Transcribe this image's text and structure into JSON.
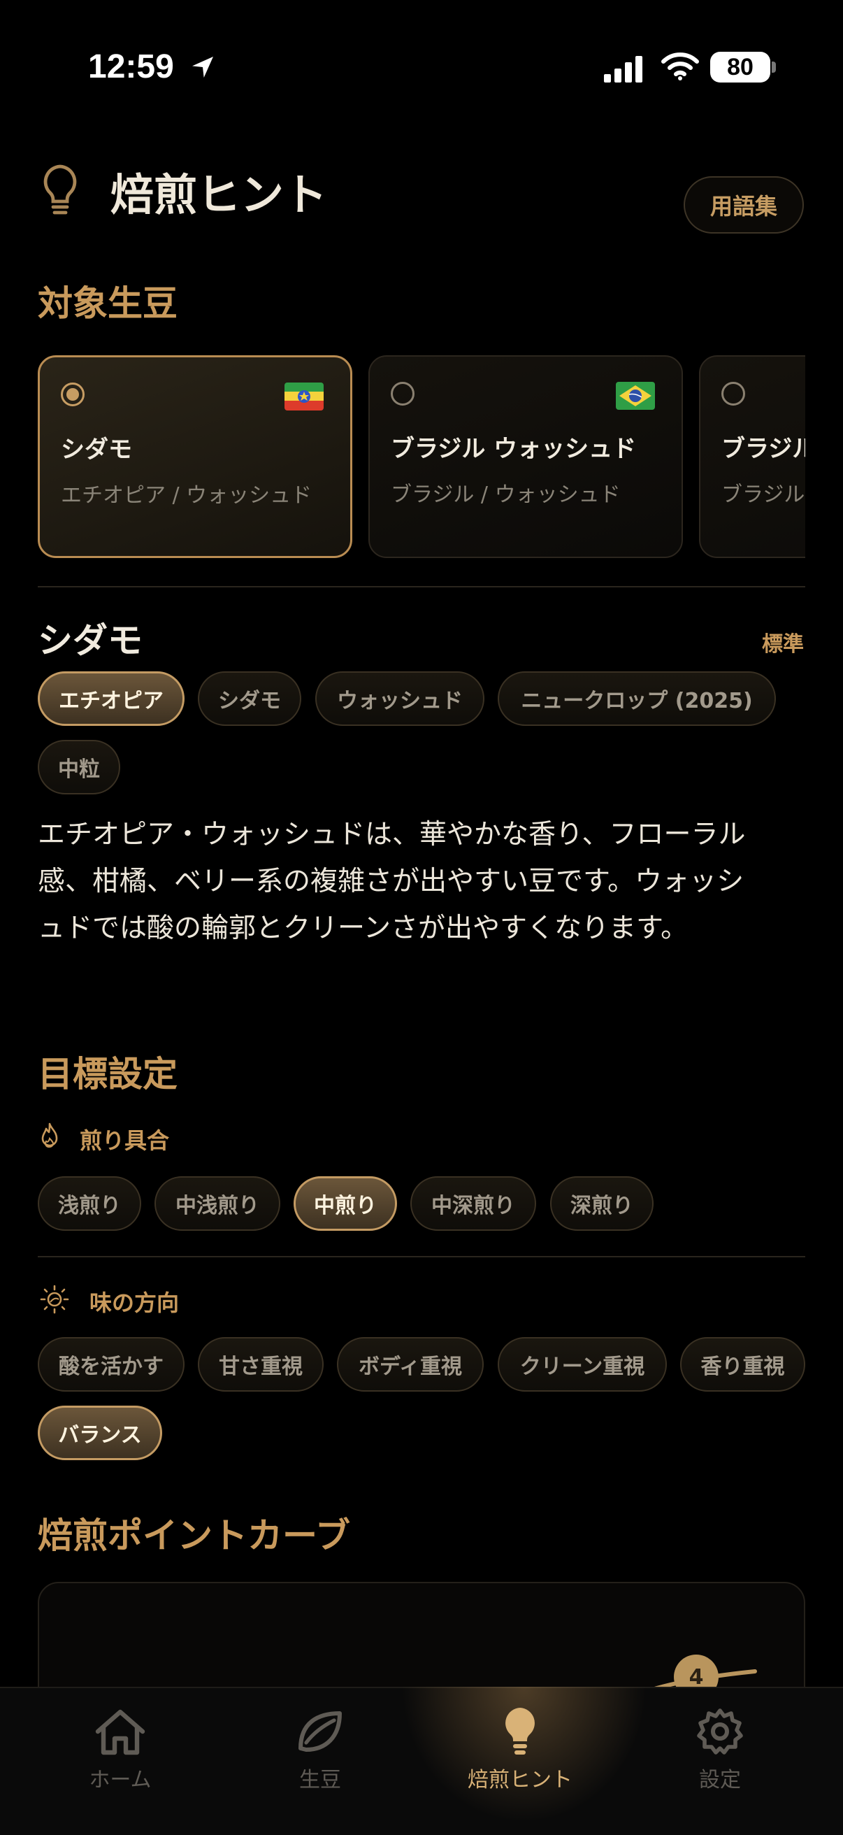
{
  "status": {
    "time": "12:59",
    "battery": "80"
  },
  "header": {
    "title": "焙煎ヒント",
    "glossary_button": "用語集"
  },
  "sections": {
    "target_beans": "対象生豆",
    "goal": "目標設定",
    "curve": "焙煎ポイントカーブ"
  },
  "beans": [
    {
      "name": "シダモ",
      "origin": "エチオピア / ウォッシュド",
      "flag": "ethiopia",
      "selected": true
    },
    {
      "name": "ブラジル ウォッシュド",
      "origin": "ブラジル / ウォッシュド",
      "flag": "brazil",
      "selected": false
    },
    {
      "name": "ブラジル",
      "origin": "ブラジル",
      "flag": "",
      "selected": false
    }
  ],
  "detail": {
    "title": "シダモ",
    "standard": "標準",
    "tags": [
      "エチオピア",
      "シダモ",
      "ウォッシュド",
      "ニュークロップ (2025)",
      "中粒"
    ],
    "description": "エチオピア・ウォッシュドは、華やかな香り、フローラル感、柑橘、ベリー系の複雑さが出やすい豆です。ウォッシュドでは酸の輪郭とクリーンさが出やすくなります。"
  },
  "roast_level": {
    "label": "煎り具合",
    "options": [
      "浅煎り",
      "中浅煎り",
      "中煎り",
      "中深煎り",
      "深煎り"
    ],
    "selected": "中煎り"
  },
  "taste_direction": {
    "label": "味の方向",
    "options": [
      "酸を活かす",
      "甘さ重視",
      "ボディ重視",
      "クリーン重視",
      "香り重視",
      "バランス"
    ],
    "selected": "バランス"
  },
  "curve": {
    "point_badge": "4"
  },
  "tabbar": [
    {
      "label": "ホーム",
      "icon": "home-icon",
      "active": false
    },
    {
      "label": "生豆",
      "icon": "leaf-icon",
      "active": false
    },
    {
      "label": "焙煎ヒント",
      "icon": "bulb-icon",
      "active": true
    },
    {
      "label": "設定",
      "icon": "gear-icon",
      "active": false
    }
  ],
  "colors": {
    "accent": "#c99a5c",
    "background": "#000000",
    "active_chip": "#6b563a"
  }
}
